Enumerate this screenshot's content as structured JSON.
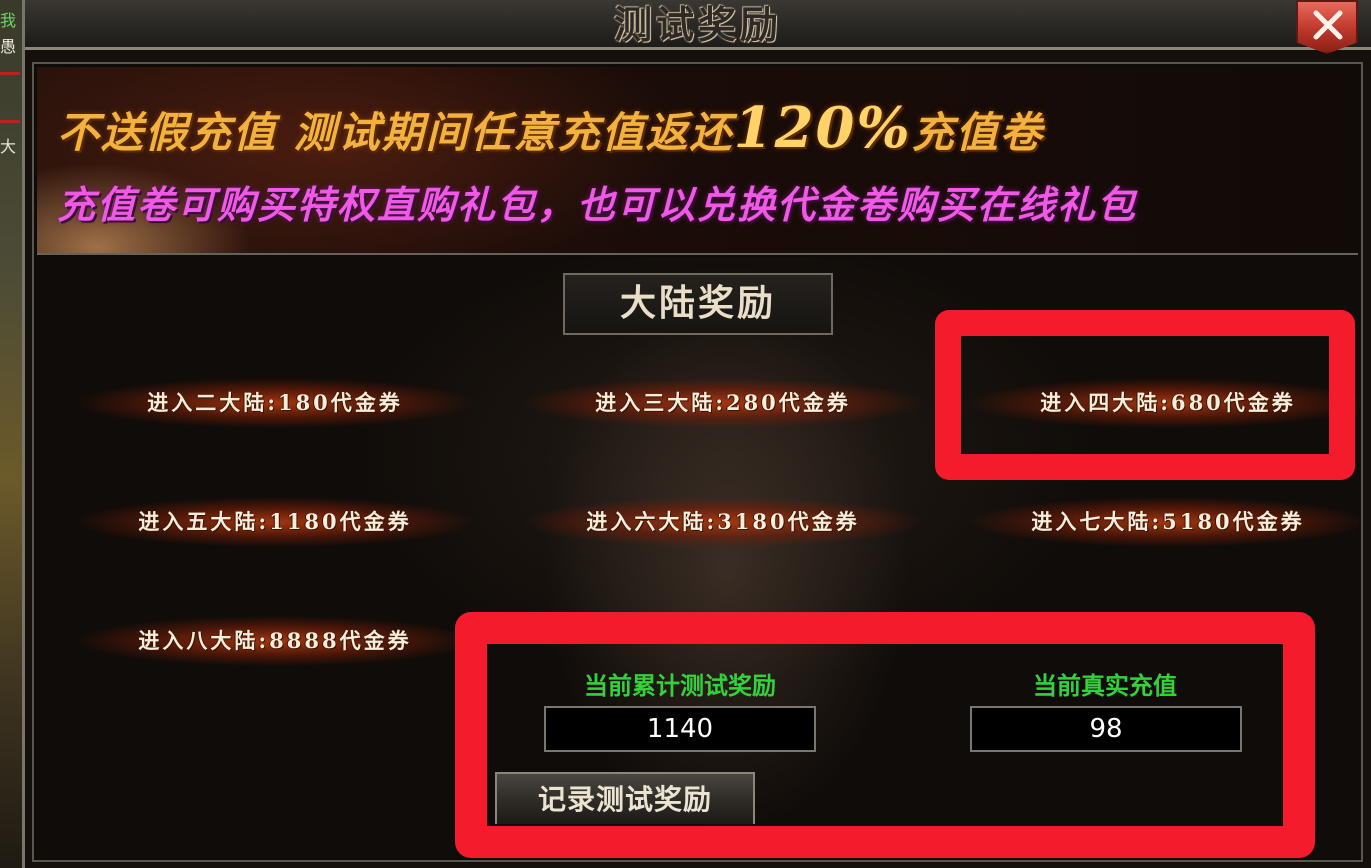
{
  "window": {
    "title": "测试奖励",
    "close_label": "close"
  },
  "edge": {
    "glyph_top": "我",
    "glyph_mid": "愚",
    "glyph_low": "大"
  },
  "banner": {
    "line1_a": "不送假充值   测试期间任意充值返还",
    "line1_pct": "120%",
    "line1_b": "充值卷",
    "line2": "充值卷可购买特权直购礼包，也可以兑换代金卷购买在线礼包"
  },
  "section_title": "大陆奖励",
  "rewards": [
    "进入二大陆:180代金券",
    "进入三大陆:280代金券",
    "进入四大陆:680代金券",
    "进入五大陆:1180代金券",
    "进入六大陆:3180代金券",
    "进入七大陆:5180代金券",
    "进入八大陆:8888代金券"
  ],
  "stats": {
    "cumulative_label": "当前累计测试奖励",
    "cumulative_value": "1140",
    "recharge_label": "当前真实充值",
    "recharge_value": "98"
  },
  "record_button": "记录测试奖励",
  "colors": {
    "highlight": "#f41c2c",
    "stat_label": "#34d23a",
    "banner_gold": "#f3b23e",
    "banner_magenta": "#f058e6"
  }
}
